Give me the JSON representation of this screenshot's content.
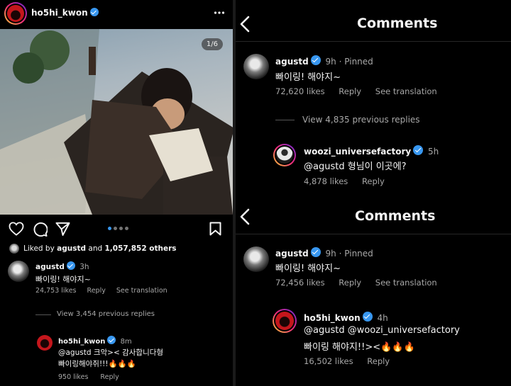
{
  "left": {
    "header": {
      "username": "ho5hi_kwon",
      "menu_icon": "more-horizontal-icon"
    },
    "photo": {
      "counter": "1/6"
    },
    "actions": {
      "like_icon": "heart-icon",
      "comment_icon": "comment-icon",
      "share_icon": "send-icon",
      "save_icon": "bookmark-icon",
      "carousel_dots": 4
    },
    "liked_by": {
      "prefix": "Liked by",
      "user": "agustd",
      "middle": "and",
      "count": "1,057,852 others"
    },
    "comment": {
      "username": "agustd",
      "time": "3h",
      "text": "빠이링! 해야지~",
      "likes": "24,753 likes",
      "reply": "Reply",
      "see_translation": "See translation"
    },
    "view_replies": "View 3,454 previous replies",
    "reply": {
      "username": "ho5hi_kwon",
      "time": "8m",
      "text_line1": "@agustd 크악>< 감사합니다형",
      "text_line2": "빠이링해야쥐!!!🔥🔥🔥",
      "likes": "950 likes",
      "reply": "Reply"
    }
  },
  "right_top": {
    "title": "Comments",
    "back_icon": "back-chevron-icon",
    "comment": {
      "username": "agustd",
      "time": "9h",
      "pinned": "Pinned",
      "text": "빠이링! 해야지~",
      "likes": "72,620 likes",
      "reply": "Reply",
      "see_translation": "See translation"
    },
    "view_replies": "View 4,835 previous replies",
    "reply": {
      "username": "woozi_universefactory",
      "time": "5h",
      "text": "@agustd 형님이 이곳에?",
      "likes": "4,878 likes",
      "reply": "Reply"
    }
  },
  "right_bottom": {
    "title": "Comments",
    "back_icon": "back-chevron-icon",
    "comment": {
      "username": "agustd",
      "time": "9h",
      "pinned": "Pinned",
      "text": "빠이링! 해야지~",
      "likes": "72,456 likes",
      "reply": "Reply",
      "see_translation": "See translation"
    },
    "reply": {
      "username": "ho5hi_kwon",
      "time": "4h",
      "text_line1": "@agustd @woozi_universefactory",
      "text_line2": "빠이링 해야지!!><🔥🔥🔥",
      "likes": "16,502 likes",
      "reply": "Reply"
    }
  },
  "colors": {
    "background": "#000000",
    "text": "#f5f5f5",
    "muted": "#a8a8a8",
    "verified": "#3897f0",
    "accent_dot": "#3897f0"
  }
}
